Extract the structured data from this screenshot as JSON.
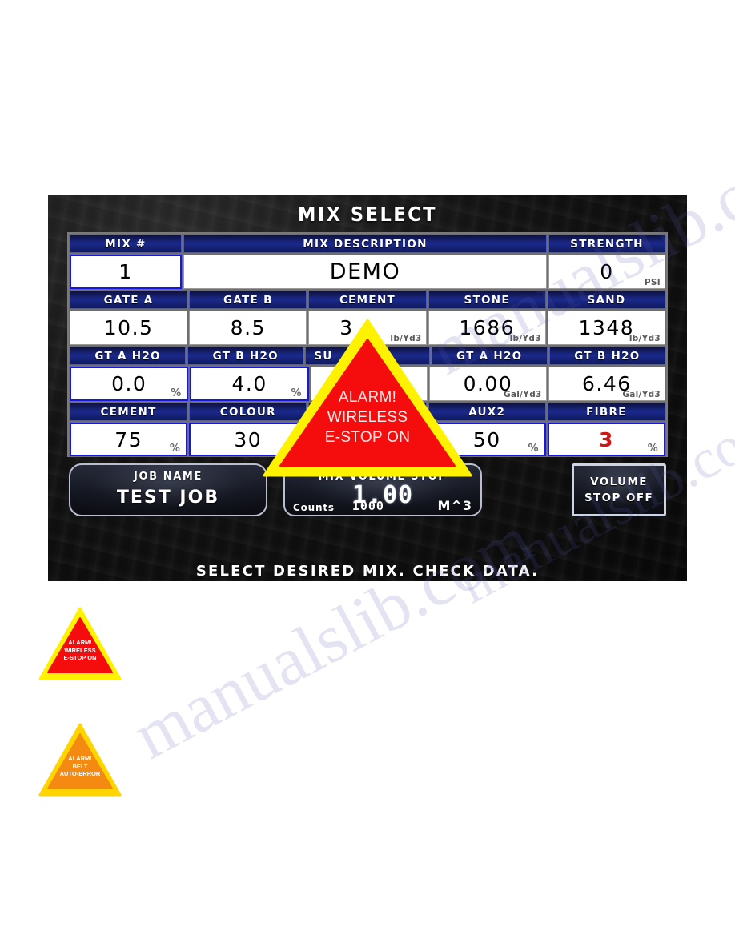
{
  "panel": {
    "title": "MIX SELECT",
    "status_message": "SELECT DESIRED MIX.  CHECK DATA."
  },
  "row_mix": {
    "headers": [
      "MIX #",
      "MIX DESCRIPTION",
      "STRENGTH"
    ],
    "mix_number": "1",
    "mix_description": "DEMO",
    "strength_value": "0",
    "strength_unit": "PSI"
  },
  "row_materials": {
    "headers": [
      "GATE A",
      "GATE B",
      "CEMENT",
      "STONE",
      "SAND"
    ],
    "values": [
      "10.5",
      "8.5",
      "3",
      "1686",
      "1348"
    ],
    "units": [
      "",
      "",
      "lb/Yd3",
      "lb/Yd3",
      "lb/Yd3"
    ]
  },
  "row_water": {
    "headers": [
      "GT A H2O",
      "GT B H2O",
      "SU",
      "GT A H2O",
      "GT B H2O"
    ],
    "values": [
      "0.0",
      "4.0",
      "",
      "0.00",
      "6.46"
    ],
    "units": [
      "%",
      "%",
      "",
      "Gal/Yd3",
      "Gal/Yd3"
    ]
  },
  "row_admix": {
    "headers": [
      "CEMENT",
      "COLOUR",
      "",
      "AUX2",
      "FIBRE"
    ],
    "values": [
      "75",
      "30",
      "",
      "50",
      "3"
    ],
    "units": [
      "%",
      "%",
      "%",
      "%",
      "%"
    ]
  },
  "controls": {
    "job_label": "JOB NAME",
    "job_value": "TEST JOB",
    "volume_label": "MIX VOLUME STOP",
    "volume_value": "1.00",
    "volume_unit": "M^3",
    "counts_label": "Counts",
    "counts_value": "1000",
    "volume_button_line1": "VOLUME",
    "volume_button_line2": "STOP OFF"
  },
  "alarm": {
    "line1": "ALARM!",
    "line2": "WIRELESS",
    "line3": "E-STOP ON",
    "fill": "#f50d0d",
    "border": "#fff200"
  },
  "legend": [
    {
      "line1": "ALARM!",
      "line2": "WIRELESS",
      "line3": "E-STOP ON",
      "fill": "#f50d0d",
      "border": "#fff200"
    },
    {
      "line1": "ALARM!",
      "line2": "BELT",
      "line3": "AUTO-ERROR",
      "fill": "#f58a12",
      "border": "#ffd400"
    }
  ],
  "watermark": {
    "text1": "manualslib.com",
    "text2": "manualslib.com",
    "text3": "manualslib.com"
  }
}
